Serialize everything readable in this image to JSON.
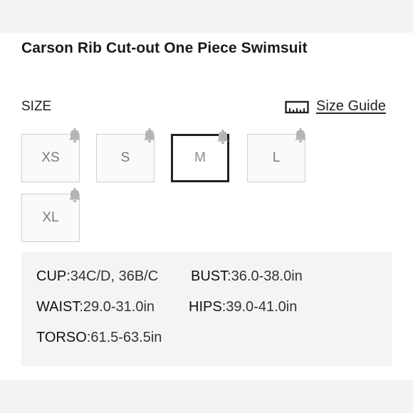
{
  "product": {
    "title": "Carson Rib Cut-out One Piece Swimsuit"
  },
  "size_selector": {
    "label": "SIZE",
    "size_guide_label": "Size Guide",
    "size_guide_icon": "ruler-icon",
    "notify_icon": "bell-icon",
    "sizes": [
      {
        "label": "XS",
        "selected": false,
        "notify": true
      },
      {
        "label": "S",
        "selected": false,
        "notify": true
      },
      {
        "label": "M",
        "selected": true,
        "notify": true
      },
      {
        "label": "L",
        "selected": false,
        "notify": true
      },
      {
        "label": "XL",
        "selected": false,
        "notify": true
      }
    ]
  },
  "measurements": {
    "cup_label": "CUP",
    "cup_value": ":34C/D, 36B/C",
    "bust_label": "BUST",
    "bust_value": ":36.0-38.0in",
    "waist_label": "WAIST",
    "waist_value": ":29.0-31.0in",
    "hips_label": "HIPS",
    "hips_value": ":39.0-41.0in",
    "torso_label": "TORSO",
    "torso_value": ":61.5-63.5in"
  },
  "colors": {
    "selected_border": "#222222",
    "unselected_border": "#cfcfcf",
    "bell": "#b5b5b5",
    "panel_bg": "#f4f4f4"
  }
}
